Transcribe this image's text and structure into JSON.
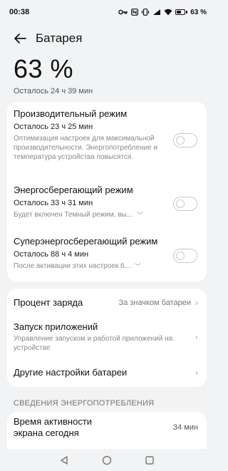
{
  "status_bar": {
    "time": "00:38",
    "battery_text": "63 %",
    "icons": [
      "key-icon",
      "nfc-icon",
      "vibrate-icon",
      "signal-icon",
      "wifi-icon",
      "battery-icon"
    ]
  },
  "header": {
    "title": "Батарея"
  },
  "battery": {
    "percent": "63 %",
    "remaining": "Осталось 24 ч 39 мин"
  },
  "modes": [
    {
      "title": "Производительный режим",
      "remaining": "Осталось 23 ч 25 мин",
      "description": "Оптимизация настроек для максимальной производительности. Энергопотребление и температура устройства повысятся.",
      "enabled": false
    },
    {
      "title": "Энергосберегающий режим",
      "remaining": "Осталось 33 ч 31 мин",
      "description": "Будет включен Темный режим, вы...",
      "enabled": false
    },
    {
      "title": "Суперэнергосберегающий режим",
      "remaining": "Осталось 88 ч 4 мин",
      "description": "После активации этих настроек б...",
      "enabled": false
    }
  ],
  "settings": {
    "charge_percent": {
      "label": "Процент заряда",
      "value": "За значком батареи"
    },
    "app_launch": {
      "label": "Запуск приложений",
      "description": "Управление запуском и работой приложений на устройстве"
    },
    "other": {
      "label": "Другие настройки батареи"
    }
  },
  "consumption": {
    "section_label": "СВЕДЕНИЯ ЭНЕРГОПОТРЕБЛЕНИЯ",
    "screen_time_label": "Время активности экрана сегодня",
    "screen_time_value": "34 мин"
  },
  "colors": {
    "background": "#f1f3f5",
    "card": "#ffffff",
    "toggle_border": "#c9c9c9"
  }
}
